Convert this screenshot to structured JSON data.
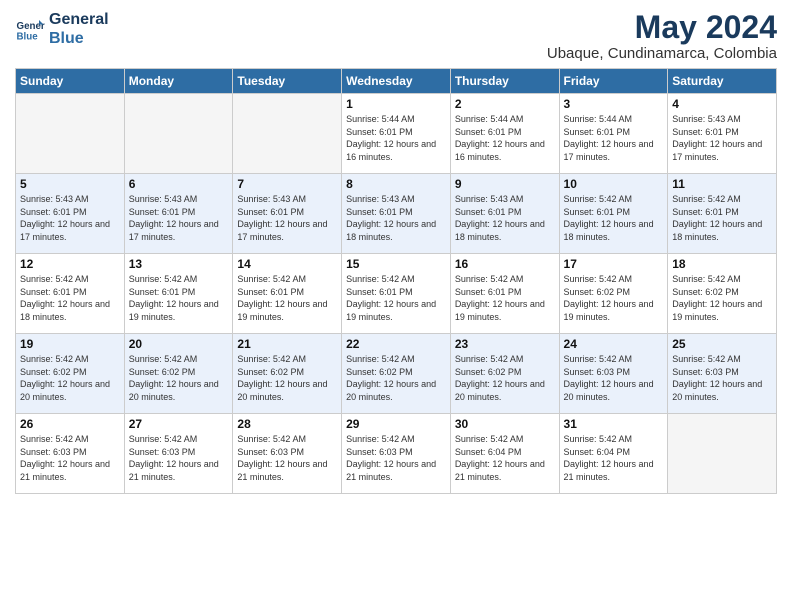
{
  "header": {
    "logo_line1": "General",
    "logo_line2": "Blue",
    "month": "May 2024",
    "location": "Ubaque, Cundinamarca, Colombia"
  },
  "weekdays": [
    "Sunday",
    "Monday",
    "Tuesday",
    "Wednesday",
    "Thursday",
    "Friday",
    "Saturday"
  ],
  "weeks": [
    [
      {
        "day": "",
        "empty": true
      },
      {
        "day": "",
        "empty": true
      },
      {
        "day": "",
        "empty": true
      },
      {
        "day": "1",
        "sunrise": "5:44 AM",
        "sunset": "6:01 PM",
        "daylight": "12 hours and 16 minutes."
      },
      {
        "day": "2",
        "sunrise": "5:44 AM",
        "sunset": "6:01 PM",
        "daylight": "12 hours and 16 minutes."
      },
      {
        "day": "3",
        "sunrise": "5:44 AM",
        "sunset": "6:01 PM",
        "daylight": "12 hours and 17 minutes."
      },
      {
        "day": "4",
        "sunrise": "5:43 AM",
        "sunset": "6:01 PM",
        "daylight": "12 hours and 17 minutes."
      }
    ],
    [
      {
        "day": "5",
        "sunrise": "5:43 AM",
        "sunset": "6:01 PM",
        "daylight": "12 hours and 17 minutes."
      },
      {
        "day": "6",
        "sunrise": "5:43 AM",
        "sunset": "6:01 PM",
        "daylight": "12 hours and 17 minutes."
      },
      {
        "day": "7",
        "sunrise": "5:43 AM",
        "sunset": "6:01 PM",
        "daylight": "12 hours and 17 minutes."
      },
      {
        "day": "8",
        "sunrise": "5:43 AM",
        "sunset": "6:01 PM",
        "daylight": "12 hours and 18 minutes."
      },
      {
        "day": "9",
        "sunrise": "5:43 AM",
        "sunset": "6:01 PM",
        "daylight": "12 hours and 18 minutes."
      },
      {
        "day": "10",
        "sunrise": "5:42 AM",
        "sunset": "6:01 PM",
        "daylight": "12 hours and 18 minutes."
      },
      {
        "day": "11",
        "sunrise": "5:42 AM",
        "sunset": "6:01 PM",
        "daylight": "12 hours and 18 minutes."
      }
    ],
    [
      {
        "day": "12",
        "sunrise": "5:42 AM",
        "sunset": "6:01 PM",
        "daylight": "12 hours and 18 minutes."
      },
      {
        "day": "13",
        "sunrise": "5:42 AM",
        "sunset": "6:01 PM",
        "daylight": "12 hours and 19 minutes."
      },
      {
        "day": "14",
        "sunrise": "5:42 AM",
        "sunset": "6:01 PM",
        "daylight": "12 hours and 19 minutes."
      },
      {
        "day": "15",
        "sunrise": "5:42 AM",
        "sunset": "6:01 PM",
        "daylight": "12 hours and 19 minutes."
      },
      {
        "day": "16",
        "sunrise": "5:42 AM",
        "sunset": "6:01 PM",
        "daylight": "12 hours and 19 minutes."
      },
      {
        "day": "17",
        "sunrise": "5:42 AM",
        "sunset": "6:02 PM",
        "daylight": "12 hours and 19 minutes."
      },
      {
        "day": "18",
        "sunrise": "5:42 AM",
        "sunset": "6:02 PM",
        "daylight": "12 hours and 19 minutes."
      }
    ],
    [
      {
        "day": "19",
        "sunrise": "5:42 AM",
        "sunset": "6:02 PM",
        "daylight": "12 hours and 20 minutes."
      },
      {
        "day": "20",
        "sunrise": "5:42 AM",
        "sunset": "6:02 PM",
        "daylight": "12 hours and 20 minutes."
      },
      {
        "day": "21",
        "sunrise": "5:42 AM",
        "sunset": "6:02 PM",
        "daylight": "12 hours and 20 minutes."
      },
      {
        "day": "22",
        "sunrise": "5:42 AM",
        "sunset": "6:02 PM",
        "daylight": "12 hours and 20 minutes."
      },
      {
        "day": "23",
        "sunrise": "5:42 AM",
        "sunset": "6:02 PM",
        "daylight": "12 hours and 20 minutes."
      },
      {
        "day": "24",
        "sunrise": "5:42 AM",
        "sunset": "6:03 PM",
        "daylight": "12 hours and 20 minutes."
      },
      {
        "day": "25",
        "sunrise": "5:42 AM",
        "sunset": "6:03 PM",
        "daylight": "12 hours and 20 minutes."
      }
    ],
    [
      {
        "day": "26",
        "sunrise": "5:42 AM",
        "sunset": "6:03 PM",
        "daylight": "12 hours and 21 minutes."
      },
      {
        "day": "27",
        "sunrise": "5:42 AM",
        "sunset": "6:03 PM",
        "daylight": "12 hours and 21 minutes."
      },
      {
        "day": "28",
        "sunrise": "5:42 AM",
        "sunset": "6:03 PM",
        "daylight": "12 hours and 21 minutes."
      },
      {
        "day": "29",
        "sunrise": "5:42 AM",
        "sunset": "6:03 PM",
        "daylight": "12 hours and 21 minutes."
      },
      {
        "day": "30",
        "sunrise": "5:42 AM",
        "sunset": "6:04 PM",
        "daylight": "12 hours and 21 minutes."
      },
      {
        "day": "31",
        "sunrise": "5:42 AM",
        "sunset": "6:04 PM",
        "daylight": "12 hours and 21 minutes."
      },
      {
        "day": "",
        "empty": true
      }
    ]
  ]
}
